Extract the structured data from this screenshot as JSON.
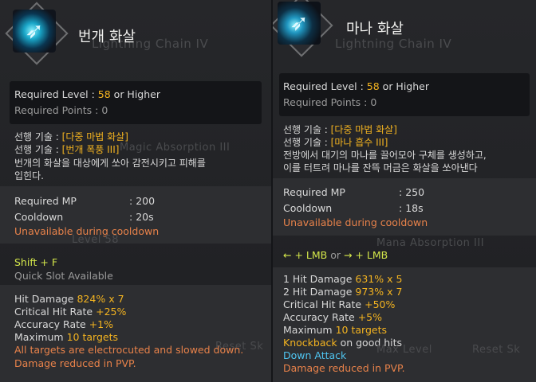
{
  "left": {
    "title": "번개 화살",
    "ghost_title": "Lightning Chain IV",
    "ghost_rows": [
      "Level 58",
      "Magic Absorption III"
    ],
    "required_level_label": "Required Level",
    "required_level_value": "58",
    "required_level_suffix": "or Higher",
    "required_points_label": "Required Points",
    "required_points_value": "0",
    "prereq_label": "선행 기술 :",
    "prereq_1": "[다중 마법 화살]",
    "prereq_2": "[번개 폭풍 III]",
    "description": [
      "번개의 화살을 대상에게 쏘아 감전시키고 피해를",
      "입힌다."
    ],
    "mp_label": "Required MP",
    "mp_value": "200",
    "cooldown_label": "Cooldown",
    "cooldown_value": "20s",
    "cooldown_note": "Unavailable during cooldown",
    "key_combo": "Shift + F",
    "quick_slot": "Quick Slot Available",
    "hit_damage_label": "Hit Damage",
    "hit_damage_value": "824% x 7",
    "crit_label": "Critical Hit Rate",
    "crit_value": "+25%",
    "accuracy_label": "Accuracy Rate",
    "accuracy_value": "+1%",
    "maximum_label": "Maximum",
    "maximum_value": "10 targets",
    "effect_1": "All targets are electrocuted and slowed down.",
    "effect_2": "Damage reduced in PVP.",
    "ghost_reset": "Reset Sk"
  },
  "right": {
    "title": "마나 화살",
    "ghost_title": "Lightning Chain IV",
    "ghost_rows": [
      "Mana Absorption III",
      "Max Level"
    ],
    "required_level_label": "Required Level",
    "required_level_value": "58",
    "required_level_suffix": "or Higher",
    "required_points_label": "Required Points",
    "required_points_value": "0",
    "prereq_label": "선행 기술 :",
    "prereq_1": "[다중 마법 화살]",
    "prereq_2": "[마나 흡수 III]",
    "description": [
      "전방에서 대기의 마나를 끌어모아 구체를 생성하고,",
      "이를 터트려 마나를 잔뜩 머금은 화살을 쏘아낸다"
    ],
    "mp_label": "Required MP",
    "mp_value": "250",
    "cooldown_label": "Cooldown",
    "cooldown_value": "18s",
    "cooldown_note": "Unavailable during cooldown",
    "key_left": "← + LMB",
    "key_or": "or",
    "key_right": "→ + LMB",
    "hit1_label": "1 Hit Damage",
    "hit1_value": "631% x 5",
    "hit2_label": "2 Hit Damage",
    "hit2_value": "973% x 7",
    "crit_label": "Critical Hit Rate",
    "crit_value": "+50%",
    "accuracy_label": "Accuracy Rate",
    "accuracy_value": "+5%",
    "maximum_label": "Maximum",
    "maximum_value": "10 targets",
    "knockback_label": "Knockback",
    "knockback_suffix": "on good hits",
    "down_attack": "Down Attack",
    "effect": "Damage reduced in PVP.",
    "ghost_reset": "Reset Sk"
  },
  "colors": {
    "gold": "#f3b320",
    "orange": "#e8824a",
    "lime": "#d3e64a",
    "cyan": "#4fc4f0"
  },
  "icons": {
    "left": "lightning-arrow-skill-icon",
    "right": "mana-arrow-skill-icon"
  }
}
